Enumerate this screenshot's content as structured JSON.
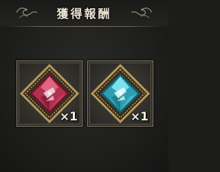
{
  "header": {
    "title": "獲得報酬"
  },
  "rewards": [
    {
      "icon": "red-crystal-shard-icon",
      "quantity": "×1",
      "gem_color": "#c83a5a"
    },
    {
      "icon": "cyan-crystal-shard-icon",
      "quantity": "×1",
      "gem_color": "#3fb8c8"
    }
  ],
  "colors": {
    "frame_gold": "#b89a5a",
    "title_text": "#e8e2cf"
  }
}
